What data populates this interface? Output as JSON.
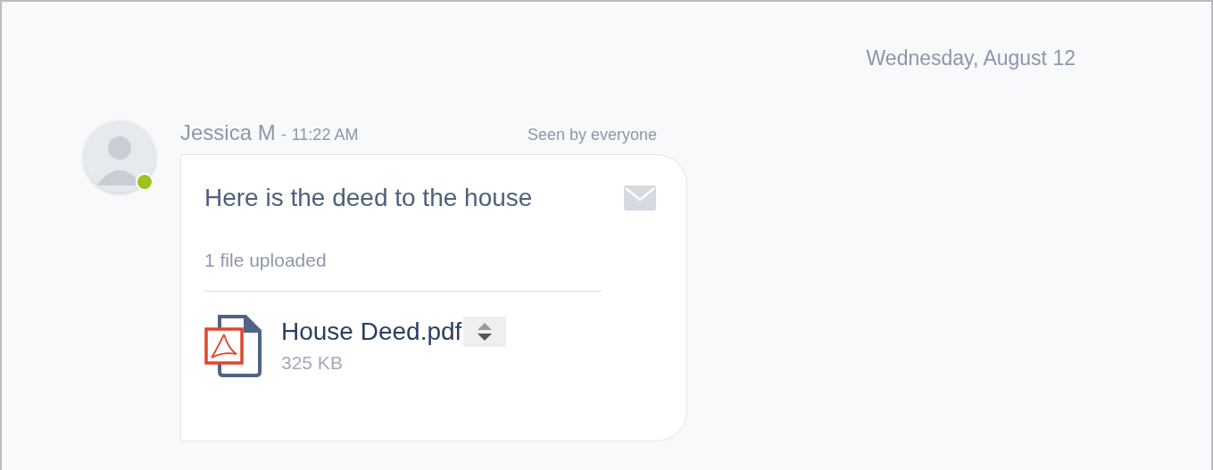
{
  "date_header": "Wednesday, August 12",
  "message": {
    "sender": "Jessica M",
    "separator": "-",
    "time": "11:22 AM",
    "seen_status": "Seen by everyone",
    "online": true,
    "text": "Here is the deed to the house",
    "upload_count": "1 file uploaded",
    "files": [
      {
        "kind": "pdf",
        "name": "House Deed.pdf",
        "size": "325 KB"
      }
    ]
  }
}
